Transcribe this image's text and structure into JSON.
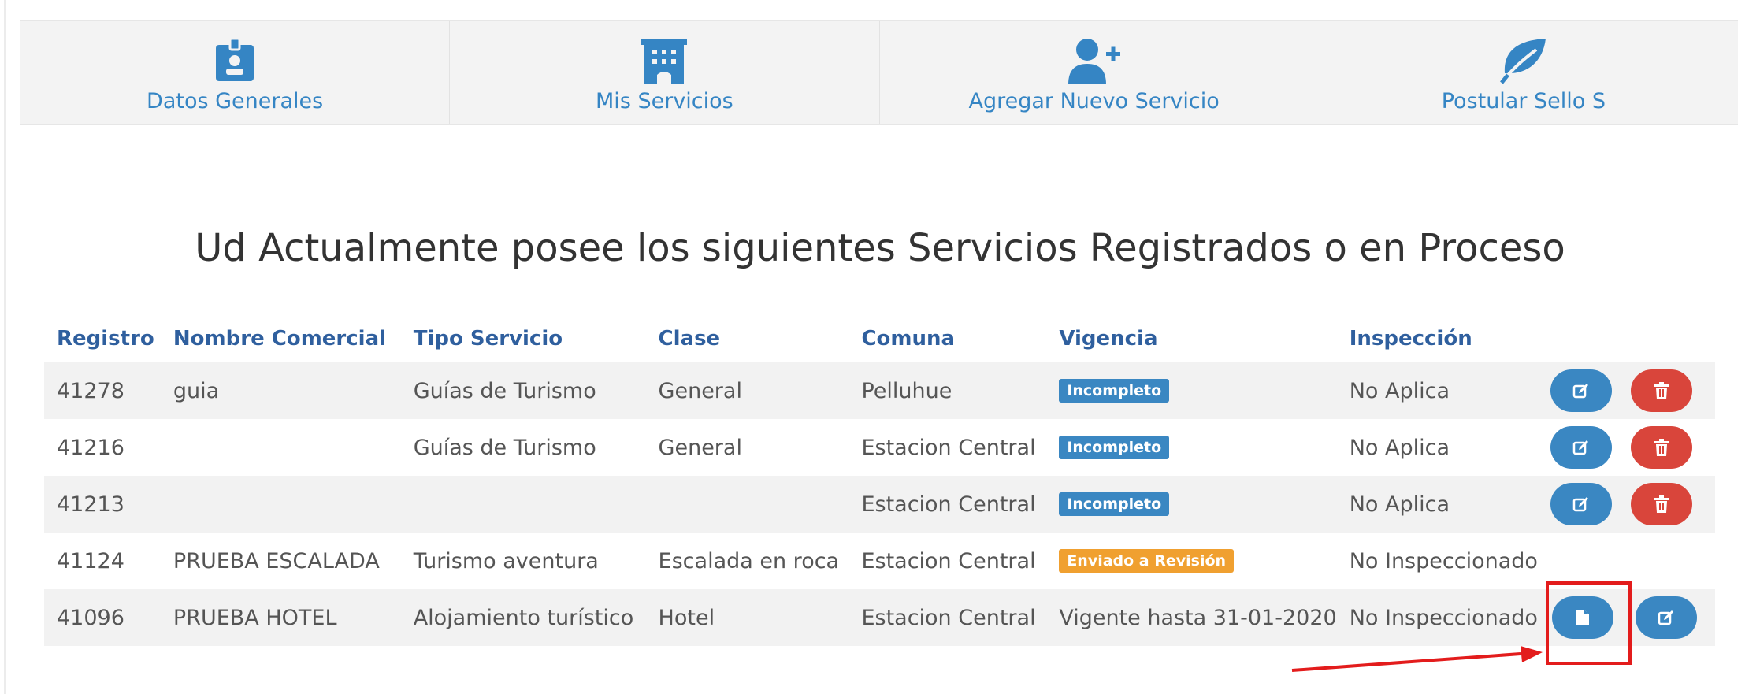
{
  "nav": {
    "tabs": [
      {
        "label": "Datos Generales",
        "icon": "id-badge-icon"
      },
      {
        "label": "Mis Servicios",
        "icon": "hotel-building-icon"
      },
      {
        "label": "Agregar Nuevo Servicio",
        "icon": "user-plus-icon"
      },
      {
        "label": "Postular Sello S",
        "icon": "leaf-icon"
      }
    ]
  },
  "headline": "Ud Actualmente posee los siguientes Servicios Registrados o en Proceso",
  "table": {
    "headers": [
      "Registro",
      "Nombre Comercial",
      "Tipo Servicio",
      "Clase",
      "Comuna",
      "Vigencia",
      "Inspección"
    ],
    "rows": [
      {
        "registro": "41278",
        "nombre": "guia",
        "tipo": "Guías de Turismo",
        "clase": "General",
        "comuna": "Pelluhue",
        "vigencia": "Incompleto",
        "inspeccion": "No Aplica"
      },
      {
        "registro": "41216",
        "nombre": "",
        "tipo": "Guías de Turismo",
        "clase": "General",
        "comuna": "Estacion Central",
        "vigencia": "Incompleto",
        "inspeccion": "No Aplica"
      },
      {
        "registro": "41213",
        "nombre": "",
        "tipo": "",
        "clase": "",
        "comuna": "Estacion Central",
        "vigencia": "Incompleto",
        "inspeccion": "No Aplica"
      },
      {
        "registro": "41124",
        "nombre": "PRUEBA ESCALADA",
        "tipo": "Turismo aventura",
        "clase": "Escalada en roca",
        "comuna": "Estacion Central",
        "vigencia": "Enviado a Revisión",
        "inspeccion": "No Inspeccionado"
      },
      {
        "registro": "41096",
        "nombre": "PRUEBA HOTEL",
        "tipo": "Alojamiento turístico",
        "clase": "Hotel",
        "comuna": "Estacion Central",
        "vigencia": "Vigente hasta 31-01-2020",
        "inspeccion": "No Inspeccionado"
      }
    ]
  },
  "colors": {
    "accent_blue": "#3a87c2",
    "danger_red": "#d9453b",
    "warning_orange": "#f0a030",
    "header_text": "#2f5f9e",
    "annotation_red": "#e31c1c"
  },
  "icons": {
    "edit": "pencil-square-icon",
    "delete": "trash-icon",
    "document": "file-icon"
  }
}
